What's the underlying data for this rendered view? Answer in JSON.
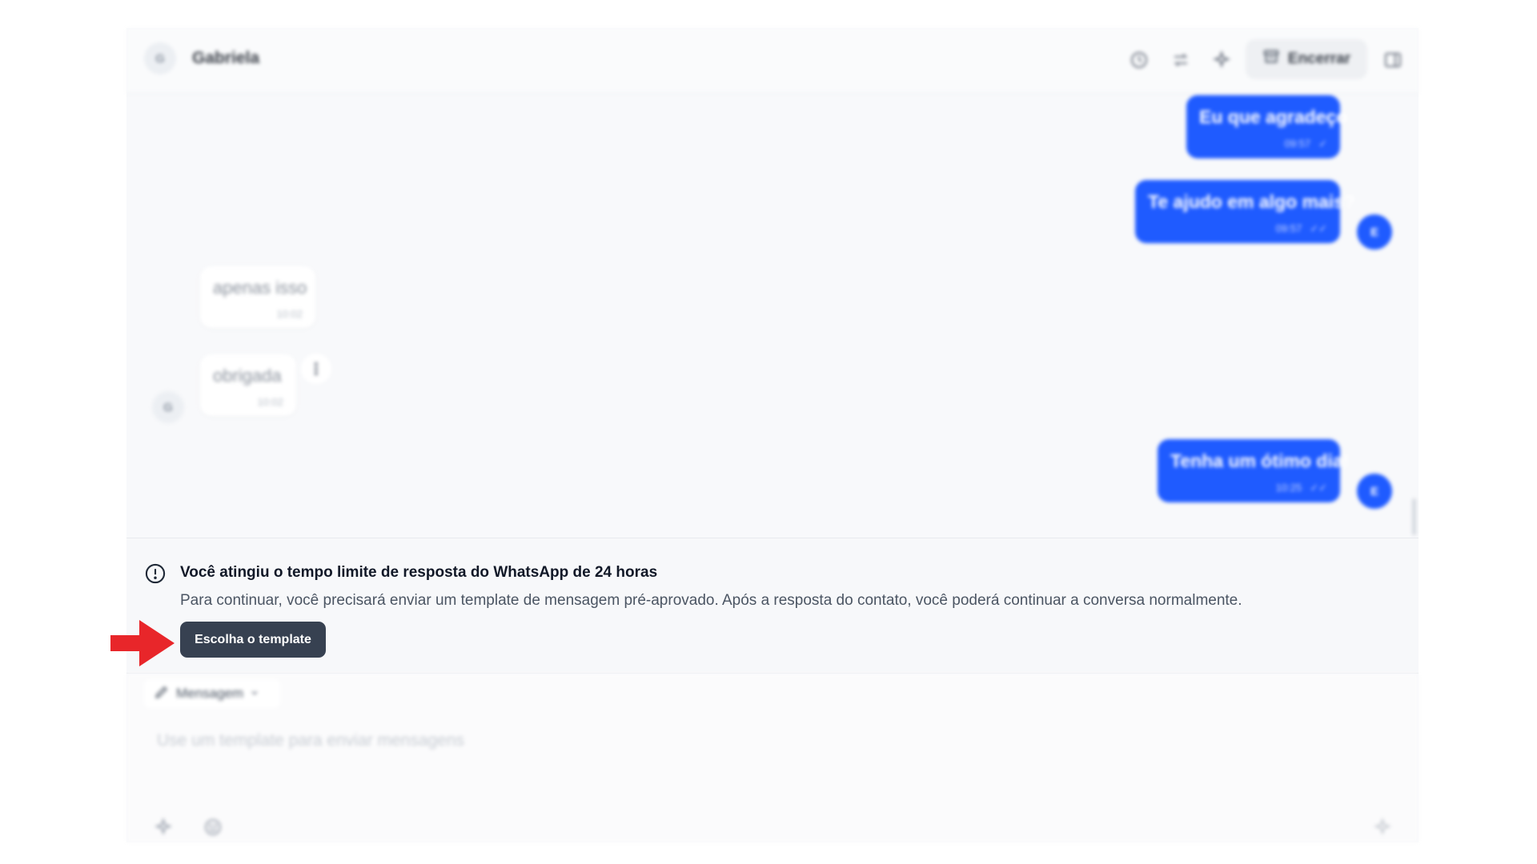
{
  "header": {
    "contact_initial": "G",
    "contact_name": "Gabriela",
    "end_label": "Encerrar",
    "icons": [
      "clock-icon",
      "transfer-icon",
      "sparkle-icon",
      "archive-icon",
      "sidebar-toggle-icon"
    ]
  },
  "messages": [
    {
      "direction": "out",
      "text": "Eu que agradeço",
      "time": "09:57"
    },
    {
      "direction": "out",
      "text": "Te ajudo em algo mais?",
      "time": "09:57"
    },
    {
      "direction": "in",
      "text": "apenas isso",
      "time": "10:02"
    },
    {
      "direction": "in",
      "text": "obrigada",
      "time": "10:02"
    },
    {
      "direction": "out",
      "text": "Tenha um ótimo dia!",
      "time": "10:25"
    }
  ],
  "agent_initial": "E",
  "menu_dots": "⋮",
  "notice": {
    "title": "Você atingiu o tempo limite de resposta do WhatsApp de 24 horas",
    "description": "Para continuar, você precisará enviar um template de mensagem pré-aprovado. Após a resposta do contato, você poderá continuar a conversa normalmente.",
    "button_label": "Escolha o template"
  },
  "composer": {
    "mode_label": "Mensagem",
    "placeholder": "Use um template para enviar mensagens"
  },
  "colors": {
    "outgoing_bubble": "#1f5bff",
    "template_button": "#374151",
    "arrow": "#e8262a"
  }
}
